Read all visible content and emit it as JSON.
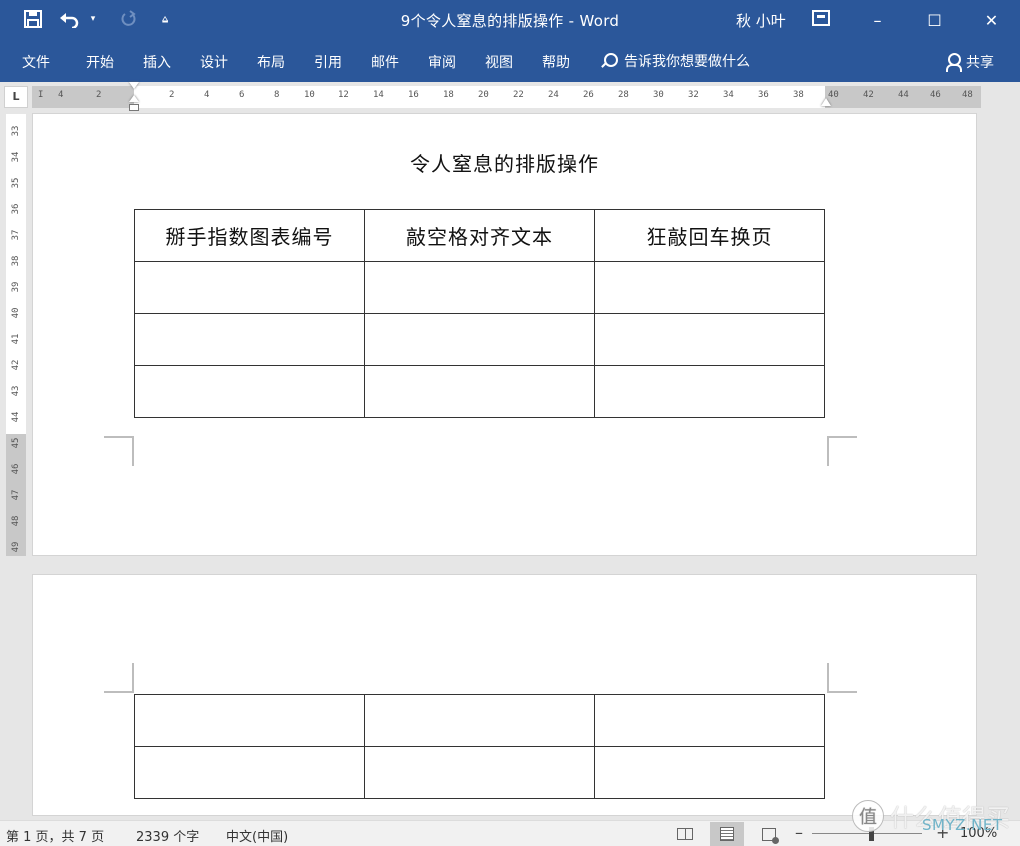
{
  "window": {
    "title": "9个令人窒息的排版操作  -  Word",
    "user": "秋 小叶",
    "buttons": {
      "minimize": "–",
      "maximize": "☐",
      "close": "✕"
    }
  },
  "qat": {
    "save_icon": "save-icon",
    "undo_icon": "undo-icon",
    "redo_icon": "redo-icon",
    "customize_icon": "customize-qat-icon"
  },
  "menu": {
    "tabs": [
      {
        "label": "文件"
      },
      {
        "label": "开始"
      },
      {
        "label": "插入"
      },
      {
        "label": "设计"
      },
      {
        "label": "布局"
      },
      {
        "label": "引用"
      },
      {
        "label": "邮件"
      },
      {
        "label": "审阅"
      },
      {
        "label": "视图"
      },
      {
        "label": "帮助"
      }
    ],
    "tell_me": "告诉我你想要做什么",
    "share": "共享"
  },
  "ruler": {
    "corner": "L",
    "h_ticks": [
      "4",
      "2",
      "2",
      "4",
      "6",
      "8",
      "10",
      "12",
      "14",
      "16",
      "18",
      "20",
      "22",
      "24",
      "26",
      "28",
      "30",
      "32",
      "34",
      "36",
      "38",
      "40",
      "42",
      "44",
      "46",
      "48"
    ],
    "v_ticks": [
      "33",
      "34",
      "35",
      "36",
      "37",
      "38",
      "39",
      "40",
      "41",
      "42",
      "43",
      "44",
      "45",
      "46",
      "47",
      "48",
      "49"
    ]
  },
  "document": {
    "title": "令人窒息的排版操作",
    "table1": {
      "header": [
        "掰手指数图表编号",
        "敲空格对齐文本",
        "狂敲回车换页"
      ],
      "rows": [
        [
          "",
          "",
          ""
        ],
        [
          "",
          "",
          ""
        ],
        [
          "",
          "",
          ""
        ]
      ]
    },
    "table2": {
      "rows": [
        [
          "",
          "",
          ""
        ],
        [
          "",
          "",
          ""
        ]
      ]
    }
  },
  "status": {
    "page": "第 1 页，共 7 页",
    "words": "2339 个字",
    "language": "中文(中国)",
    "zoom": "100%",
    "zoom_minus": "–",
    "zoom_plus": "+"
  },
  "watermark": {
    "glyph": "值",
    "text": "什么值得买",
    "sub": "SMYZ.NET"
  }
}
